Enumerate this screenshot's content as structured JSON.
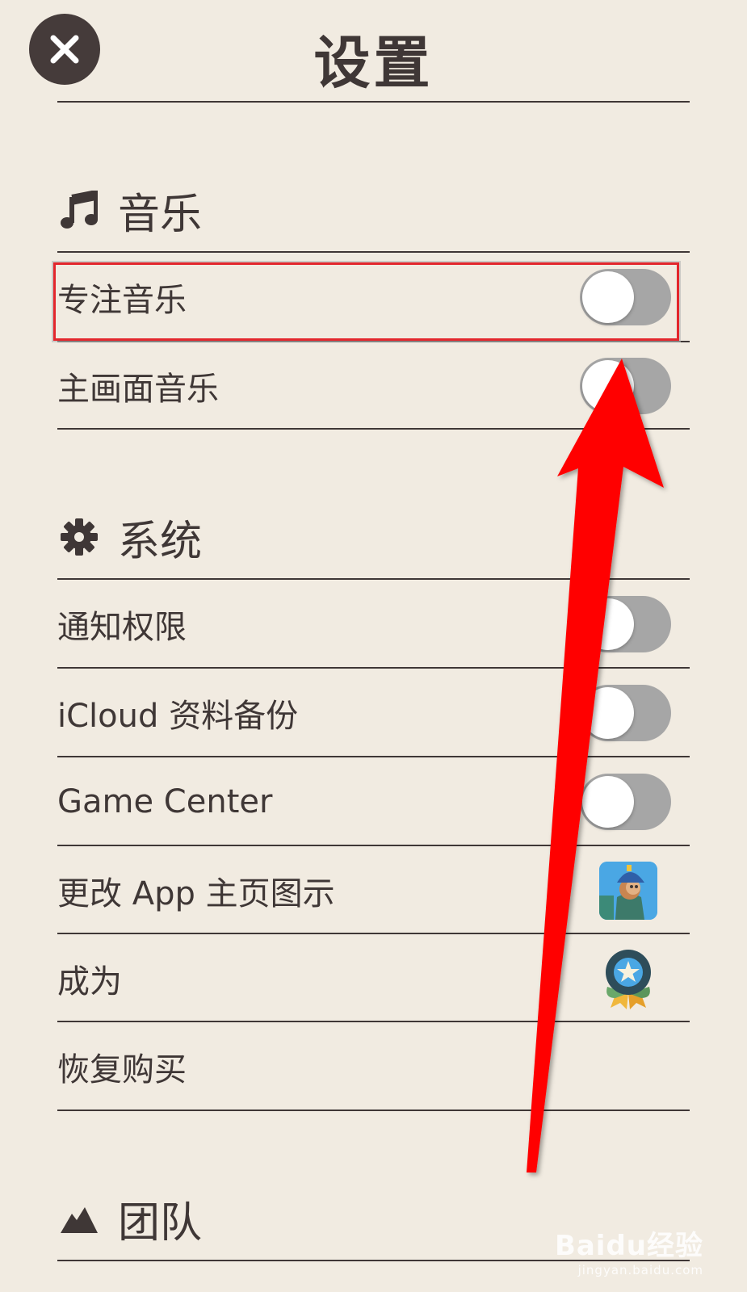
{
  "header": {
    "title": "设置",
    "close_icon": "close-icon"
  },
  "music": {
    "title": "音乐",
    "icon": "music-note-icon",
    "items": [
      {
        "label": "专注音乐",
        "toggle": "off"
      },
      {
        "label": "主画面音乐",
        "toggle": "off"
      }
    ]
  },
  "system": {
    "title": "系统",
    "icon": "gear-icon",
    "items": [
      {
        "label": "通知权限",
        "toggle": "off"
      },
      {
        "label": "iCloud 资料备份",
        "toggle": "off"
      },
      {
        "label": "Game Center",
        "toggle": "off"
      },
      {
        "label": "更改 App 主页图示",
        "icon": "app-icon-thumbnail"
      },
      {
        "label": "成为",
        "icon": "medal-icon"
      },
      {
        "label": "恢复购买"
      }
    ]
  },
  "team": {
    "title": "团队",
    "icon": "mountain-icon"
  },
  "annotation": {
    "highlight_color": "#e3262c",
    "arrow_color": "#ff0000"
  },
  "watermark": {
    "brand": "Baidu经验",
    "url": "jingyan.baidu.com"
  }
}
